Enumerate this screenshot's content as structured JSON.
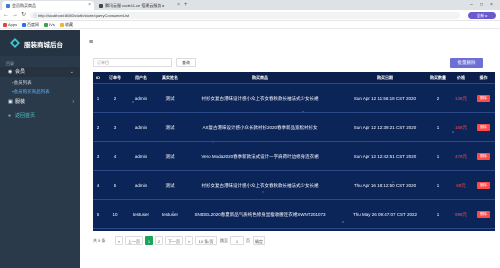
{
  "browser": {
    "tabs": [
      {
        "title": "会员购买商品",
        "active": true
      },
      {
        "title": "腾讯云服 code11.cn 搭建云服务 ▸",
        "active": false
      }
    ],
    "url": "http://localhost:8080/cloth/store/queryConsumerList",
    "profile_label": "全新 ▸",
    "bookmarks": [
      {
        "label": "Apps"
      },
      {
        "label": "百度网"
      },
      {
        "label": "IVs"
      },
      {
        "label": "收藏"
      }
    ]
  },
  "sidebar": {
    "brand": "服装商城后台",
    "section_label": "目录",
    "items": [
      {
        "label": "会员",
        "icon": "user-icon",
        "expanded": true
      },
      {
        "label": "会员列表",
        "icon": "list-icon"
      },
      {
        "label": "会员购买商品列表",
        "icon": "cart-icon"
      },
      {
        "label": "服装",
        "icon": "shirt-icon"
      },
      {
        "label": "返回首页",
        "icon": "home-icon"
      }
    ]
  },
  "toolbar": {
    "search_placeholder": "订单目",
    "search_label": "查询",
    "batch_label": "批量删除"
  },
  "table": {
    "columns": [
      "ID",
      "订单号",
      "用户名",
      "真实姓名",
      "购买商品",
      "购买日期",
      "购买数量",
      "价格",
      "操作"
    ],
    "rows": [
      {
        "id": "1",
        "order": "2",
        "user": "admin",
        "name": "测试",
        "product": "衬衫女复古港味设计感小众上衣女春秋款长袖法式少女长裙",
        "date": "Sun Apr 12 11:56:18 CST 2020",
        "qty": "2",
        "price": "138元",
        "action": "删除"
      },
      {
        "id": "2",
        "order": "3",
        "user": "admin",
        "name": "测试",
        "product": "AS复古港味设计感小众长款衬衫2020春季新品宽松衬衫女",
        "date": "Sun Apr 12 12:39:21 CST 2020",
        "qty": "1",
        "price": "168元",
        "action": "删除"
      },
      {
        "id": "3",
        "order": "4",
        "user": "admin",
        "name": "测试",
        "product": "Vero Moda2020春季新款法式设计一字肩荷叶边修身连衣裙",
        "date": "Sun Apr 12 12:42:51 CST 2020",
        "qty": "1",
        "price": "479元",
        "action": "删除"
      },
      {
        "id": "4",
        "order": "5",
        "user": "admin",
        "name": "测试",
        "product": "衬衫女复古港味设计感小众上衣女春秋款长袖法式少女长裙",
        "date": "Thu Apr 16 18:12:50 CST 2020",
        "qty": "1",
        "price": "69元",
        "action": "删除"
      },
      {
        "id": "5",
        "order": "10",
        "user": "testuser",
        "name": "testuser",
        "product": "SNIDEL2020春夏新品气质纯色修身显瘦收腰连衣裙SWNT201073",
        "date": "Thu May 26 09:47:07 CST 2022",
        "qty": "1",
        "price": "998元",
        "action": "删除"
      }
    ]
  },
  "pager": {
    "total": "共 5 条",
    "prev": "上一页",
    "pages": [
      "1",
      "2"
    ],
    "next": "下一页",
    "page_size": "10 条/页",
    "goto_label": "跳至",
    "goto_value": "1",
    "page_unit": "页",
    "confirm": "确定"
  },
  "colors": {
    "sidebar_bg": "#2b3a4a",
    "table_bg": "#0c2559",
    "price": "#ff4a4a",
    "accent": "#6b6fd6",
    "active_page": "#18a558"
  }
}
